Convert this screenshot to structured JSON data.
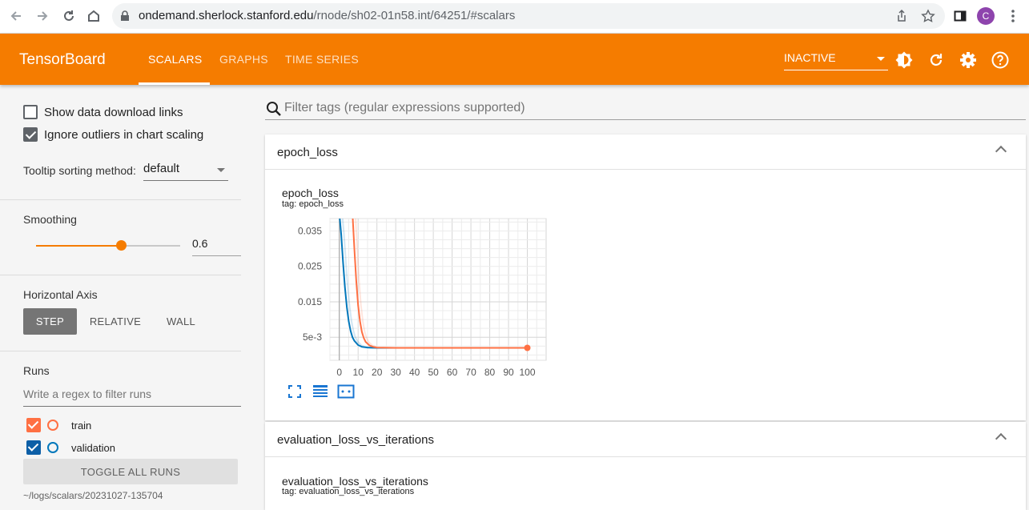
{
  "browser": {
    "url_host": "ondemand.sherlock.stanford.edu",
    "url_path": "/rnode/sh02-01n58.int/64251/#scalars",
    "avatar_letter": "C"
  },
  "header": {
    "logo": "TensorBoard",
    "tabs": [
      {
        "label": "SCALARS",
        "active": true
      },
      {
        "label": "GRAPHS",
        "active": false
      },
      {
        "label": "TIME SERIES",
        "active": false
      }
    ],
    "status_select": "INACTIVE",
    "accent": "#f57c00"
  },
  "sidebar": {
    "show_download_links": {
      "label": "Show data download links",
      "checked": false
    },
    "ignore_outliers": {
      "label": "Ignore outliers in chart scaling",
      "checked": true
    },
    "tooltip_sorting": {
      "label": "Tooltip sorting method:",
      "value": "default"
    },
    "smoothing": {
      "label": "Smoothing",
      "value": "0.6",
      "fraction": 0.6
    },
    "horizontal_axis": {
      "label": "Horizontal Axis",
      "options": [
        "STEP",
        "RELATIVE",
        "WALL"
      ],
      "selected": "STEP"
    },
    "runs": {
      "label": "Runs",
      "filter_placeholder": "Write a regex to filter runs",
      "items": [
        {
          "name": "train",
          "color": "#ff7043",
          "checked": true
        },
        {
          "name": "validation",
          "color": "#0077bb",
          "checked": true
        }
      ],
      "toggle_all": "TOGGLE ALL RUNS",
      "logdir": "~/logs/scalars/20231027-135704"
    }
  },
  "main": {
    "filter_placeholder": "Filter tags (regular expressions supported)",
    "cards": [
      {
        "title": "epoch_loss",
        "chart_title": "epoch_loss",
        "chart_tag": "tag: epoch_loss"
      },
      {
        "title": "evaluation_loss_vs_iterations",
        "chart_title": "evaluation_loss_vs_iterations",
        "chart_tag": "tag: evaluation_loss_vs_iterations"
      }
    ]
  },
  "chart_data": {
    "type": "line",
    "title": "epoch_loss",
    "x_ticks": [
      "0",
      "10",
      "20",
      "30",
      "40",
      "50",
      "60",
      "70",
      "80",
      "90",
      "100"
    ],
    "y_ticks": [
      "5e-3",
      "0.015",
      "0.025",
      "0.035"
    ],
    "y_tick_values": [
      0.005,
      0.015,
      0.025,
      0.035
    ],
    "xlim": [
      -5,
      110
    ],
    "ylim": [
      -0.0015,
      0.0385
    ],
    "grid": true,
    "series": [
      {
        "name": "validation",
        "color": "#0077bb",
        "x": [
          0,
          1,
          2,
          3,
          4,
          5,
          6,
          7,
          8,
          10,
          12,
          15,
          20,
          30,
          50,
          70,
          100
        ],
        "y": [
          0.04,
          0.034,
          0.026,
          0.019,
          0.0135,
          0.0095,
          0.0068,
          0.005,
          0.004,
          0.0028,
          0.0023,
          0.0021,
          0.002,
          0.002,
          0.002,
          0.002,
          0.002
        ]
      },
      {
        "name": "train",
        "color": "#ff7043",
        "x": [
          7,
          8,
          9,
          10,
          11,
          12,
          13,
          14,
          16,
          18,
          20,
          30,
          50,
          70,
          100
        ],
        "y": [
          0.04,
          0.03,
          0.021,
          0.014,
          0.0095,
          0.0065,
          0.0048,
          0.0037,
          0.0027,
          0.0023,
          0.0021,
          0.002,
          0.002,
          0.002,
          0.002
        ]
      }
    ]
  }
}
